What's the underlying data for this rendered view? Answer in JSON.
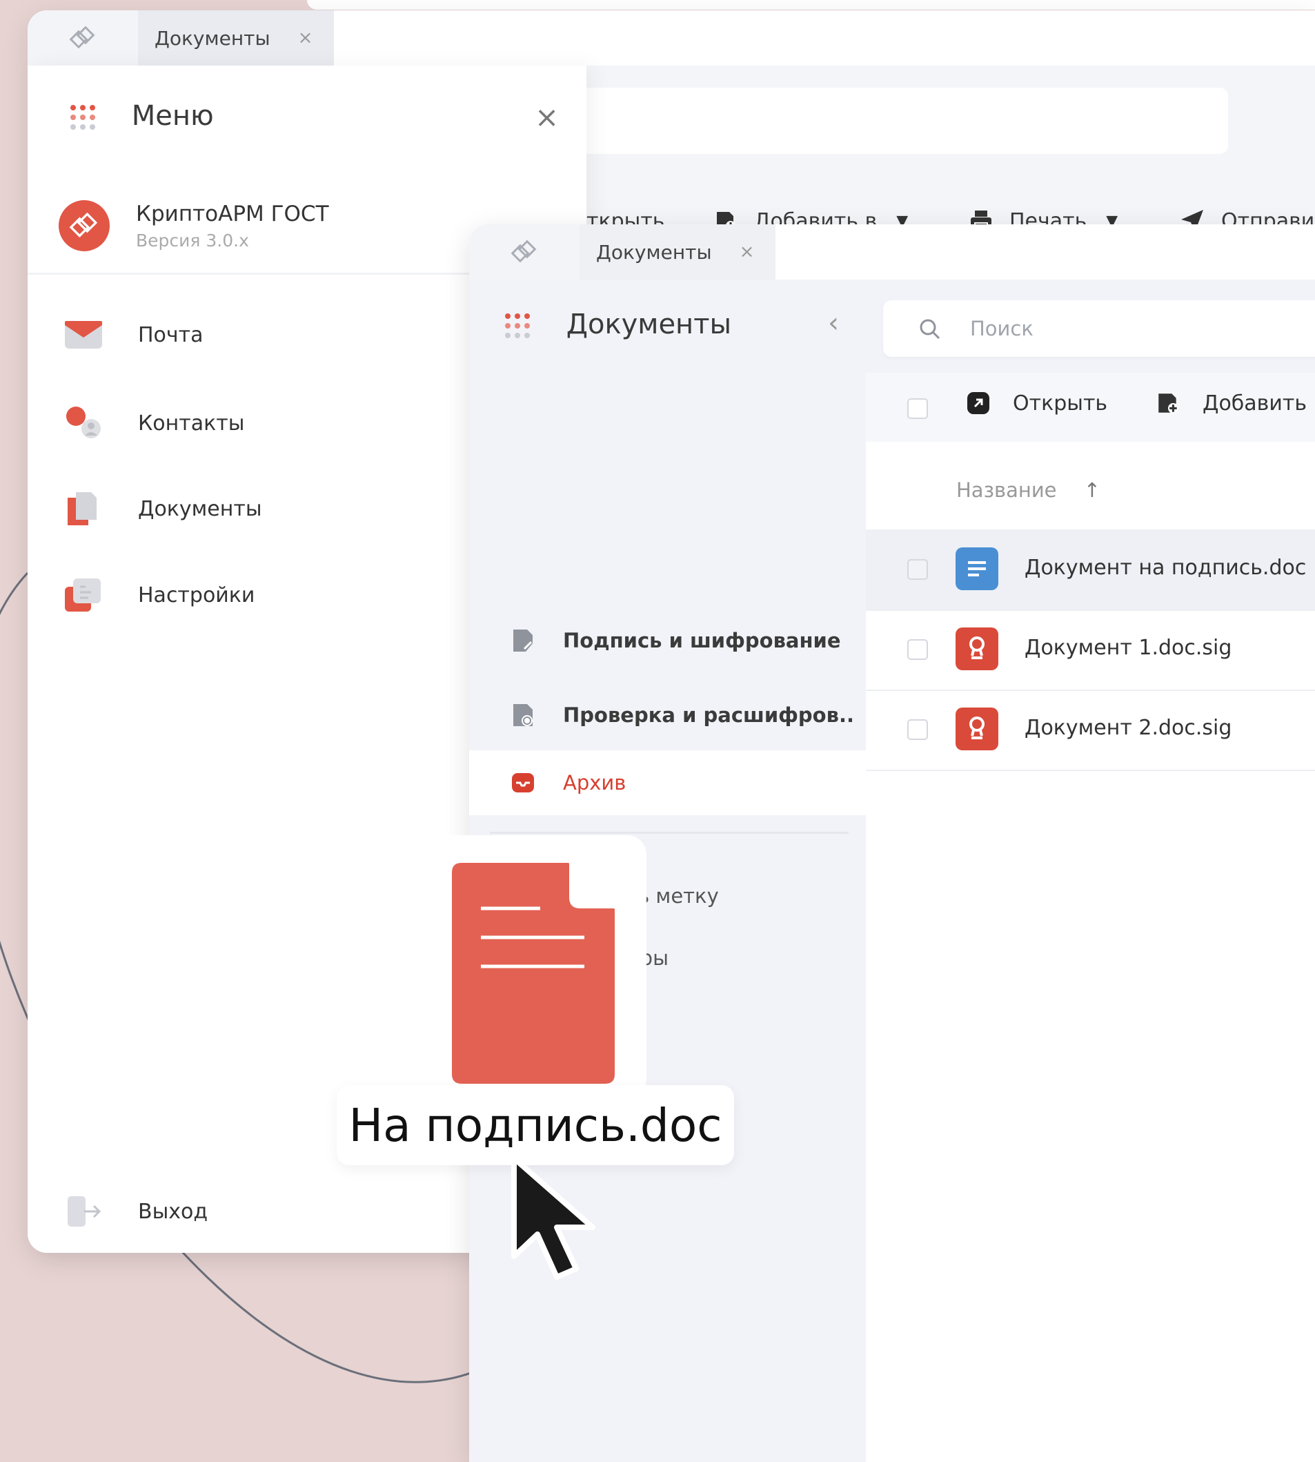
{
  "back_window": {
    "tab_title": "Документы",
    "tab_close": "×",
    "toolbar": {
      "open": "ткрыть",
      "add_to": "Добавить в",
      "print": "Печать",
      "send": "Отправи"
    }
  },
  "menu": {
    "title": "Меню",
    "close": "×",
    "app": {
      "name": "КриптоАРМ ГОСТ",
      "version": "Версия 3.0.x"
    },
    "items": [
      {
        "label": "Почта",
        "icon": "mail-icon"
      },
      {
        "label": "Контакты",
        "icon": "contacts-icon"
      },
      {
        "label": "Документы",
        "icon": "documents-icon"
      },
      {
        "label": "Настройки",
        "icon": "settings-icon"
      }
    ],
    "logout": "Выход"
  },
  "front_window": {
    "tab_title": "Документы",
    "tab_close": "×",
    "sidebar": {
      "title": "Документы",
      "back": "‹",
      "items": [
        {
          "label": "Подпись и шифрование",
          "icon": "sign-encrypt-icon"
        },
        {
          "label": "Проверка и расшифров..",
          "icon": "verify-decrypt-icon"
        },
        {
          "label": "Архив",
          "icon": "archive-icon"
        }
      ],
      "create_label": "Создать метку",
      "tags": [
        {
          "label": "Партнеры",
          "color": "#4b3f9a"
        }
      ]
    },
    "search_placeholder": "Поиск",
    "toolbar": {
      "open": "Открыть",
      "add_to": "Добавить в"
    },
    "column_name": "Название",
    "sort_arrow": "↑",
    "files": [
      {
        "name": "Документ на подпись.doc",
        "icon": "doc-file-icon",
        "color": "#4a8fd4"
      },
      {
        "name": "Документ 1.doc.sig",
        "icon": "signature-file-icon",
        "color": "#d94a3a"
      },
      {
        "name": "Документ 2.doc.sig",
        "icon": "signature-file-icon",
        "color": "#d94a3a"
      }
    ]
  },
  "drag": {
    "label": "На подпись.doc",
    "color": "#e36152"
  },
  "colors": {
    "accent": "#e15645",
    "active_text": "#d7402f",
    "background": "#e6d3d2"
  }
}
